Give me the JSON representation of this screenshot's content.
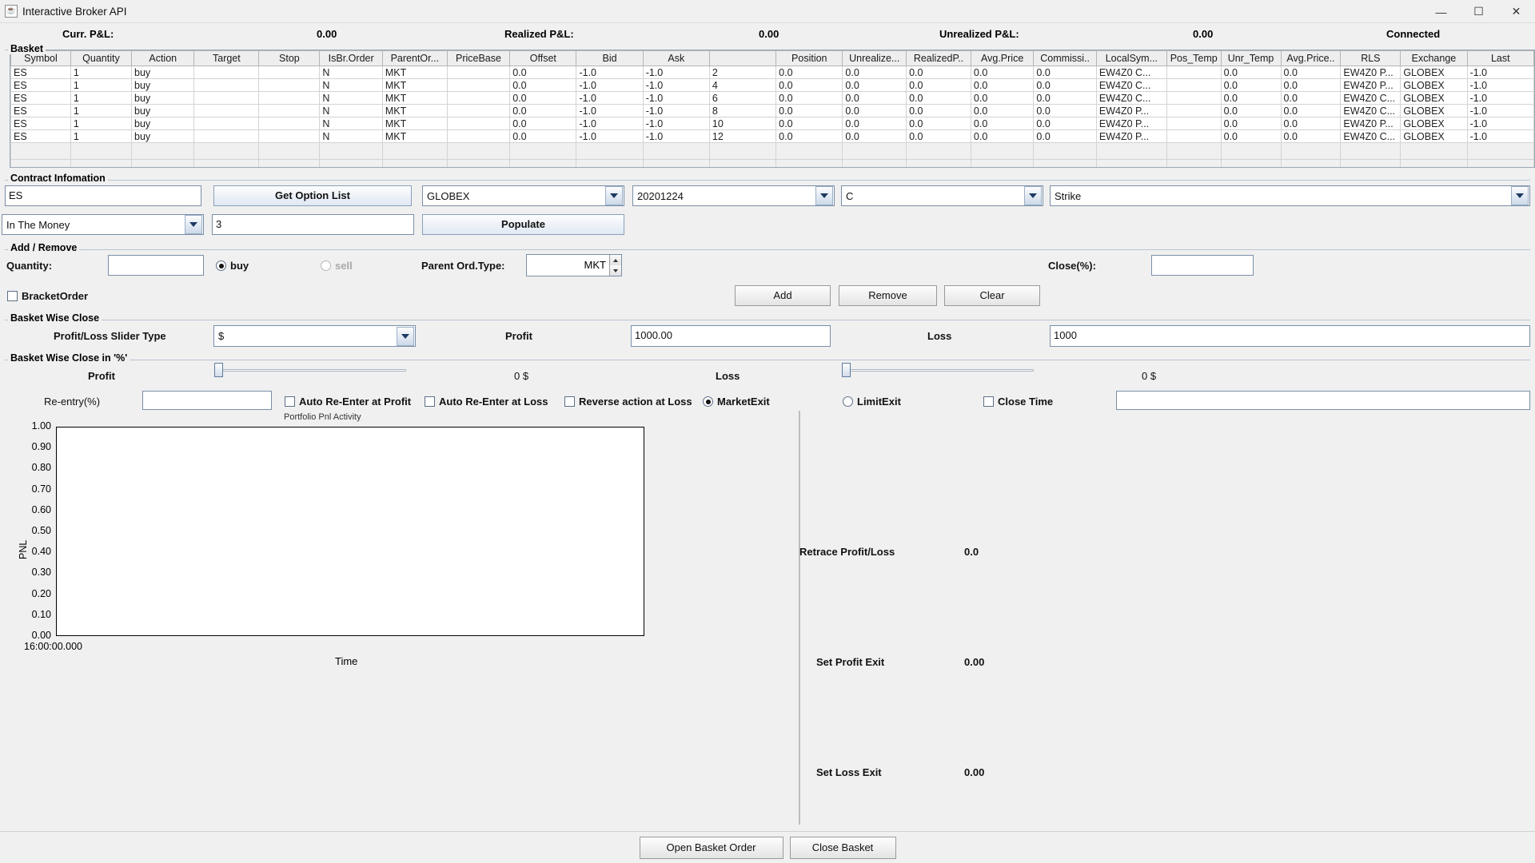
{
  "window": {
    "title": "Interactive Broker API",
    "icon": "java-coffee-cup-icon",
    "minimize": "—",
    "maximize": "☐",
    "close": "✕"
  },
  "pnl_bar": {
    "curr_label": "Curr. P&L:",
    "curr_value": "0.00",
    "realized_label": "Realized P&L:",
    "realized_value": "0.00",
    "unrealized_label": "Unrealized P&L:",
    "unrealized_value": "0.00",
    "connection_status": "Connected"
  },
  "basket": {
    "group_title": "Basket",
    "columns": [
      "Symbol",
      "Quantity",
      "Action",
      "Target",
      "Stop",
      "IsBr.Order",
      "ParentOr...",
      "PriceBase",
      "Offset",
      "Bid",
      "Ask",
      "",
      "Position",
      "Unrealize...",
      "RealizedP..",
      "Avg.Price",
      "Commissi..",
      "LocalSym...",
      "Pos_Temp",
      "Unr_Temp",
      "Avg.Price..",
      "RLS",
      "Exchange",
      "Last"
    ],
    "rows": [
      [
        "ES",
        "1",
        "buy",
        "",
        "",
        "N",
        "MKT",
        "",
        "0.0",
        "-1.0",
        "-1.0",
        "2",
        "0.0",
        "0.0",
        "0.0",
        "0.0",
        "0.0",
        "EW4Z0 C...",
        "",
        "0.0",
        "0.0",
        "EW4Z0 P...",
        "GLOBEX",
        "-1.0"
      ],
      [
        "ES",
        "1",
        "buy",
        "",
        "",
        "N",
        "MKT",
        "",
        "0.0",
        "-1.0",
        "-1.0",
        "4",
        "0.0",
        "0.0",
        "0.0",
        "0.0",
        "0.0",
        "EW4Z0 C...",
        "",
        "0.0",
        "0.0",
        "EW4Z0 P...",
        "GLOBEX",
        "-1.0"
      ],
      [
        "ES",
        "1",
        "buy",
        "",
        "",
        "N",
        "MKT",
        "",
        "0.0",
        "-1.0",
        "-1.0",
        "6",
        "0.0",
        "0.0",
        "0.0",
        "0.0",
        "0.0",
        "EW4Z0 C...",
        "",
        "0.0",
        "0.0",
        "EW4Z0 C...",
        "GLOBEX",
        "-1.0"
      ],
      [
        "ES",
        "1",
        "buy",
        "",
        "",
        "N",
        "MKT",
        "",
        "0.0",
        "-1.0",
        "-1.0",
        "8",
        "0.0",
        "0.0",
        "0.0",
        "0.0",
        "0.0",
        "EW4Z0 P...",
        "",
        "0.0",
        "0.0",
        "EW4Z0 C...",
        "GLOBEX",
        "-1.0"
      ],
      [
        "ES",
        "1",
        "buy",
        "",
        "",
        "N",
        "MKT",
        "",
        "0.0",
        "-1.0",
        "-1.0",
        "10",
        "0.0",
        "0.0",
        "0.0",
        "0.0",
        "0.0",
        "EW4Z0 P...",
        "",
        "0.0",
        "0.0",
        "EW4Z0 P...",
        "GLOBEX",
        "-1.0"
      ],
      [
        "ES",
        "1",
        "buy",
        "",
        "",
        "N",
        "MKT",
        "",
        "0.0",
        "-1.0",
        "-1.0",
        "12",
        "0.0",
        "0.0",
        "0.0",
        "0.0",
        "0.0",
        "EW4Z0 P...",
        "",
        "0.0",
        "0.0",
        "EW4Z0 C...",
        "GLOBEX",
        "-1.0"
      ]
    ]
  },
  "contract": {
    "group_title": "Contract Infomation",
    "symbol_value": "ES",
    "get_option_list_label": "Get Option List",
    "exchange_value": "GLOBEX",
    "expiry_value": "20201224",
    "right_value": "C",
    "strike_value": "Strike",
    "moneyness_value": "In The Money",
    "count_value": "3",
    "populate_label": "Populate"
  },
  "add_remove": {
    "group_title": "Add / Remove",
    "quantity_label": "Quantity:",
    "quantity_value": "",
    "buy_label": "buy",
    "sell_label": "sell",
    "buy_selected": true,
    "parent_ord_type_label": "Parent Ord.Type:",
    "parent_ord_type_value": "MKT",
    "close_pct_label": "Close(%):",
    "close_pct_value": "",
    "bracket_order_label": "BracketOrder",
    "bracket_order_checked": false,
    "add_label": "Add",
    "remove_label": "Remove",
    "clear_label": "Clear"
  },
  "basket_close": {
    "group_title": "Basket Wise Close",
    "slider_type_label": "Profit/Loss Slider Type",
    "slider_type_value": "$",
    "profit_label": "Profit",
    "profit_value": "1000.00",
    "loss_label": "Loss",
    "loss_value": "1000"
  },
  "basket_close_pct": {
    "group_title": "Basket Wise Close in '%'",
    "profit_label": "Profit",
    "profit_slider_value": "0 $",
    "profit_slider_pos_pct": 0,
    "loss_label": "Loss",
    "loss_slider_value": "0 $",
    "loss_slider_pos_pct": 0
  },
  "reentry": {
    "label": "Re-entry(%)",
    "value": "",
    "auto_reenter_profit_label": "Auto Re-Enter at Profit",
    "auto_reenter_profit_checked": false,
    "auto_reenter_loss_label": "Auto Re-Enter at Loss",
    "auto_reenter_loss_checked": false,
    "reverse_action_label": "Reverse action at Loss",
    "reverse_action_checked": false,
    "market_exit_label": "MarketExit",
    "market_exit_selected": true,
    "limit_exit_label": "LimitExit",
    "limit_exit_selected": false,
    "close_time_label": "Close Time",
    "close_time_checked": false,
    "close_time_value": ""
  },
  "side_stats": {
    "retrace_label": "Retrace Profit/Loss",
    "retrace_value": "0.0",
    "set_profit_exit_label": "Set Profit Exit",
    "set_profit_exit_value": "0.00",
    "set_loss_exit_label": "Set Loss Exit",
    "set_loss_exit_value": "0.00"
  },
  "footer": {
    "open_basket_label": "Open Basket Order",
    "close_basket_label": "Close Basket"
  },
  "chart_data": {
    "type": "line",
    "title": "Portfolio Pnl Activity",
    "xlabel": "Time",
    "ylabel": "PNL",
    "ylim": [
      0.0,
      1.0
    ],
    "ytick_labels": [
      "1.00",
      "0.90",
      "0.80",
      "0.70",
      "0.60",
      "0.50",
      "0.40",
      "0.30",
      "0.20",
      "0.10",
      "0.00"
    ],
    "ytick_values": [
      1.0,
      0.9,
      0.8,
      0.7,
      0.6,
      0.5,
      0.4,
      0.3,
      0.2,
      0.1,
      0.0
    ],
    "xtick_labels": [
      "16:00:00.000"
    ],
    "grid": false,
    "legend": "none",
    "series": [
      {
        "name": "PNL",
        "x": [],
        "values": []
      }
    ]
  }
}
